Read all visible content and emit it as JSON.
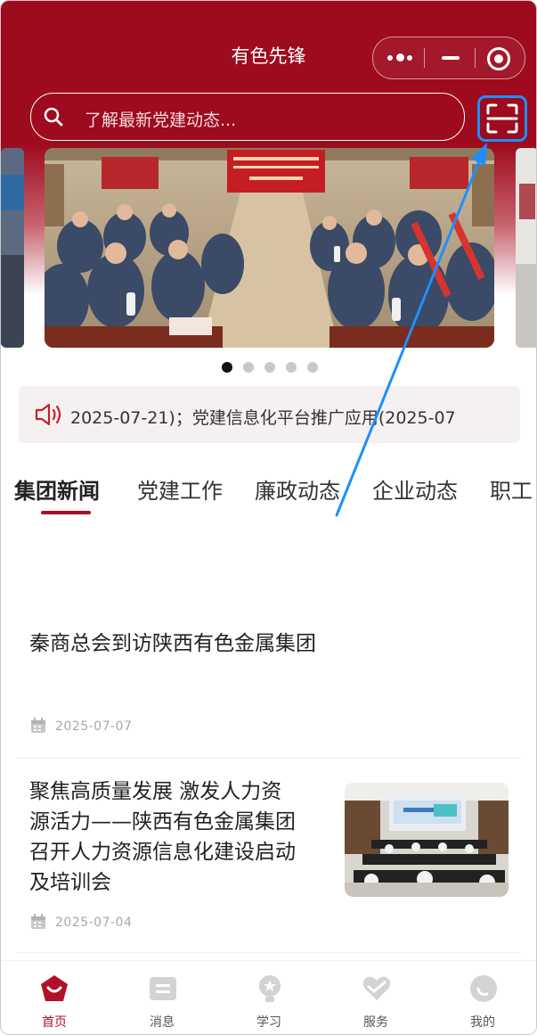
{
  "app": {
    "title": "有色先锋"
  },
  "search": {
    "placeholder": "了解最新党建动态..."
  },
  "carousel": {
    "page_count": 5,
    "active_index": 0
  },
  "notice": {
    "text": "2025-07-21)；党建信息化平台推广应用(2025-07"
  },
  "tabs": [
    {
      "label": "集团新闻"
    },
    {
      "label": "党建工作"
    },
    {
      "label": "廉政动态"
    },
    {
      "label": "企业动态"
    },
    {
      "label": "职工"
    }
  ],
  "news": [
    {
      "title": "秦商总会到访陕西有色金属集团",
      "date": "2025-07-07"
    },
    {
      "title_lines": [
        "聚焦高质量发展 激发人力资",
        "源活力——陕西有色金属集团",
        "召开人力资源信息化建设启动",
        "及培训会"
      ],
      "date": "2025-07-04"
    }
  ],
  "tabbar": [
    {
      "label": "首页"
    },
    {
      "label": "消息"
    },
    {
      "label": "学习"
    },
    {
      "label": "服务"
    },
    {
      "label": "我的"
    }
  ],
  "colors": {
    "brand": "#9e0a1e",
    "highlight": "#1e8fff"
  },
  "icons": [
    "more-dots-icon",
    "minimize-icon",
    "close-target-icon",
    "search-icon",
    "scan-icon",
    "speaker-icon",
    "calendar-icon",
    "home-icon",
    "message-icon",
    "study-icon",
    "service-icon",
    "profile-icon"
  ]
}
